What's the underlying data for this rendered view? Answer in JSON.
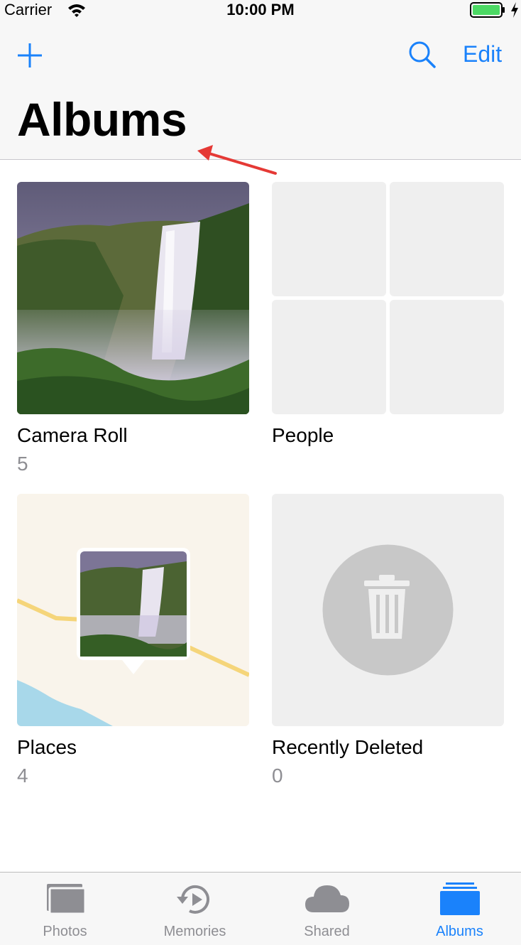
{
  "status_bar": {
    "carrier": "Carrier",
    "time": "10:00 PM"
  },
  "nav": {
    "title": "Albums",
    "edit_label": "Edit"
  },
  "albums": [
    {
      "name": "Camera Roll",
      "count": "5"
    },
    {
      "name": "People",
      "count": ""
    },
    {
      "name": "Places",
      "count": "4"
    },
    {
      "name": "Recently Deleted",
      "count": "0"
    }
  ],
  "tabs": [
    {
      "label": "Photos",
      "icon": "photos-icon"
    },
    {
      "label": "Memories",
      "icon": "memories-icon"
    },
    {
      "label": "Shared",
      "icon": "cloud-icon"
    },
    {
      "label": "Albums",
      "icon": "albums-icon"
    }
  ],
  "colors": {
    "accent": "#1a82fb",
    "annotation": "#e53935",
    "battery": "#4cd964"
  }
}
